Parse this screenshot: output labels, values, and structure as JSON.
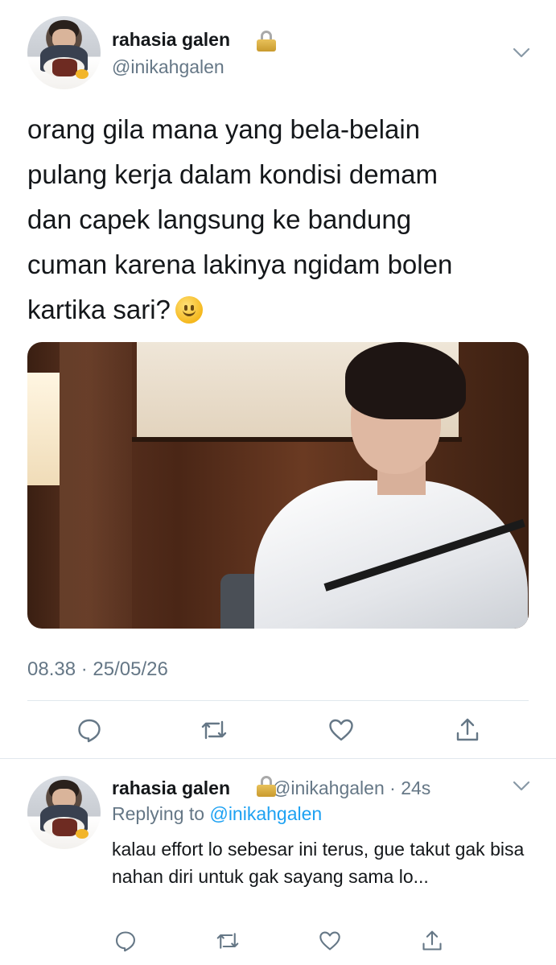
{
  "tweet": {
    "display_name": "rahasia galen",
    "handle": "@inikahgalen",
    "text": "orang gila mana yang bela-belain\npulang kerja dalam kondisi demam\ndan capek langsung ke bandung\ncuman karena lakinya ngidam bolen\nkartika sari?",
    "timestamp": "08.38 · 25/05/26",
    "icons": [
      "lock-icon",
      "chevron-down-icon",
      "slightly-smiling-face-emoji",
      "reply-icon",
      "retweet-icon",
      "like-icon",
      "share-icon"
    ]
  },
  "reply": {
    "display_name": "rahasia galen",
    "handle": "@inikahgalen",
    "time": "24s",
    "replying_label": "Replying to",
    "replying_handle": "@inikahgalen",
    "text": "kalau effort lo sebesar ini terus, gue takut gak bisa nahan diri untuk gak sayang sama lo..."
  },
  "colors": {
    "text": "#14171a",
    "secondary": "#657786",
    "link": "#1da1f2",
    "divider": "#e1e8ed"
  }
}
